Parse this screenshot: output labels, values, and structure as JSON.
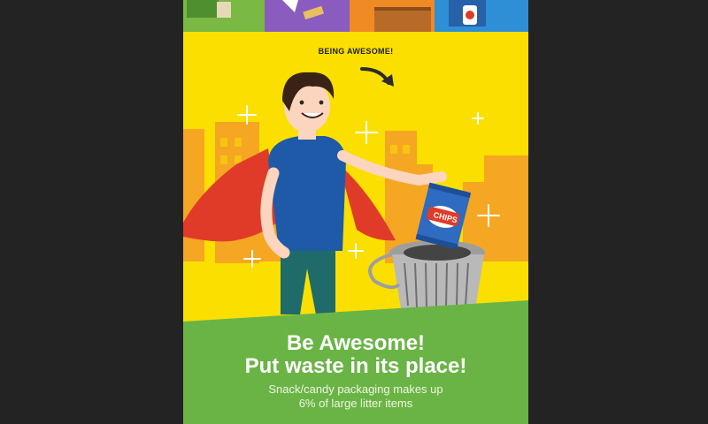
{
  "poster": {
    "tag": "BEING AWESOME!",
    "chips_label": "CHIPS",
    "headline_line1": "Be Awesome!",
    "headline_line2": "Put waste in its place!",
    "subtext_line1": "Snack/candy packaging makes up",
    "subtext_line2": "6% of large litter items"
  },
  "colors": {
    "page_background": "#232323",
    "poster_yellow": "#fadf00",
    "building_orange": "#f5a623",
    "grass_green": "#6ab446",
    "cape_red": "#e03b28",
    "shirt_blue": "#1f5aa8",
    "chips_blue": "#2f6bc0",
    "bin_grey": "#9e9e9e"
  },
  "icons": [
    "arrow-icon",
    "sparkle-icon",
    "chips-bag-icon",
    "trash-bin-icon"
  ]
}
